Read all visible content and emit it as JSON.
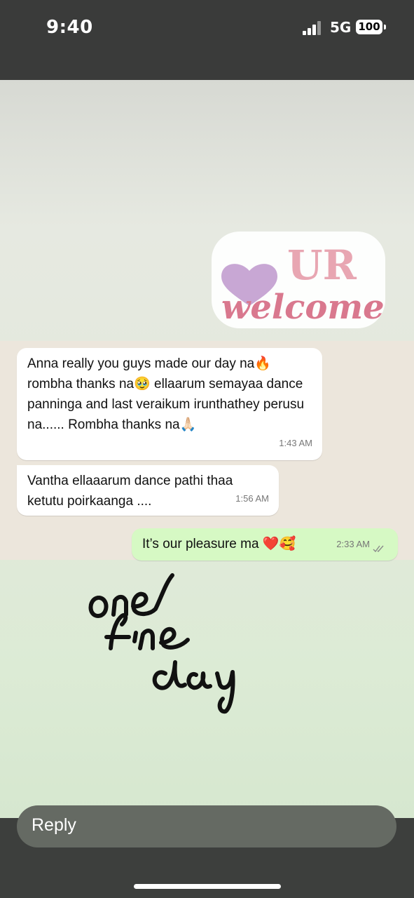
{
  "status_bar": {
    "time": "9:40",
    "network": "5G",
    "battery": "100"
  },
  "stickers": {
    "welcome_line1": "UR",
    "welcome_line2": "welcome",
    "day_line1": "one",
    "day_line2": "fine",
    "day_line3": "day"
  },
  "messages": [
    {
      "direction": "incoming",
      "text": "Anna really you guys made our day na🔥 rombha thanks na🥹 ellaarum semayaa dance panninga and last veraikum irunthathey perusu na...... Rombha thanks na🙏🏻",
      "time": "1:43 AM"
    },
    {
      "direction": "incoming",
      "text": "Vantha ellaaarum dance pathi thaa ketutu poirkaanga ....",
      "time": "1:56 AM"
    },
    {
      "direction": "outgoing",
      "text": "It’s our pleasure ma ❤️🥰",
      "time": "2:33 AM",
      "status": "read"
    }
  ],
  "reply": {
    "label": "Reply"
  },
  "colors": {
    "incoming_bubble": "#ffffff",
    "outgoing_bubble": "#d6f9c4",
    "heart": "#c8a7d4",
    "welcome_text": "#d9788e"
  }
}
